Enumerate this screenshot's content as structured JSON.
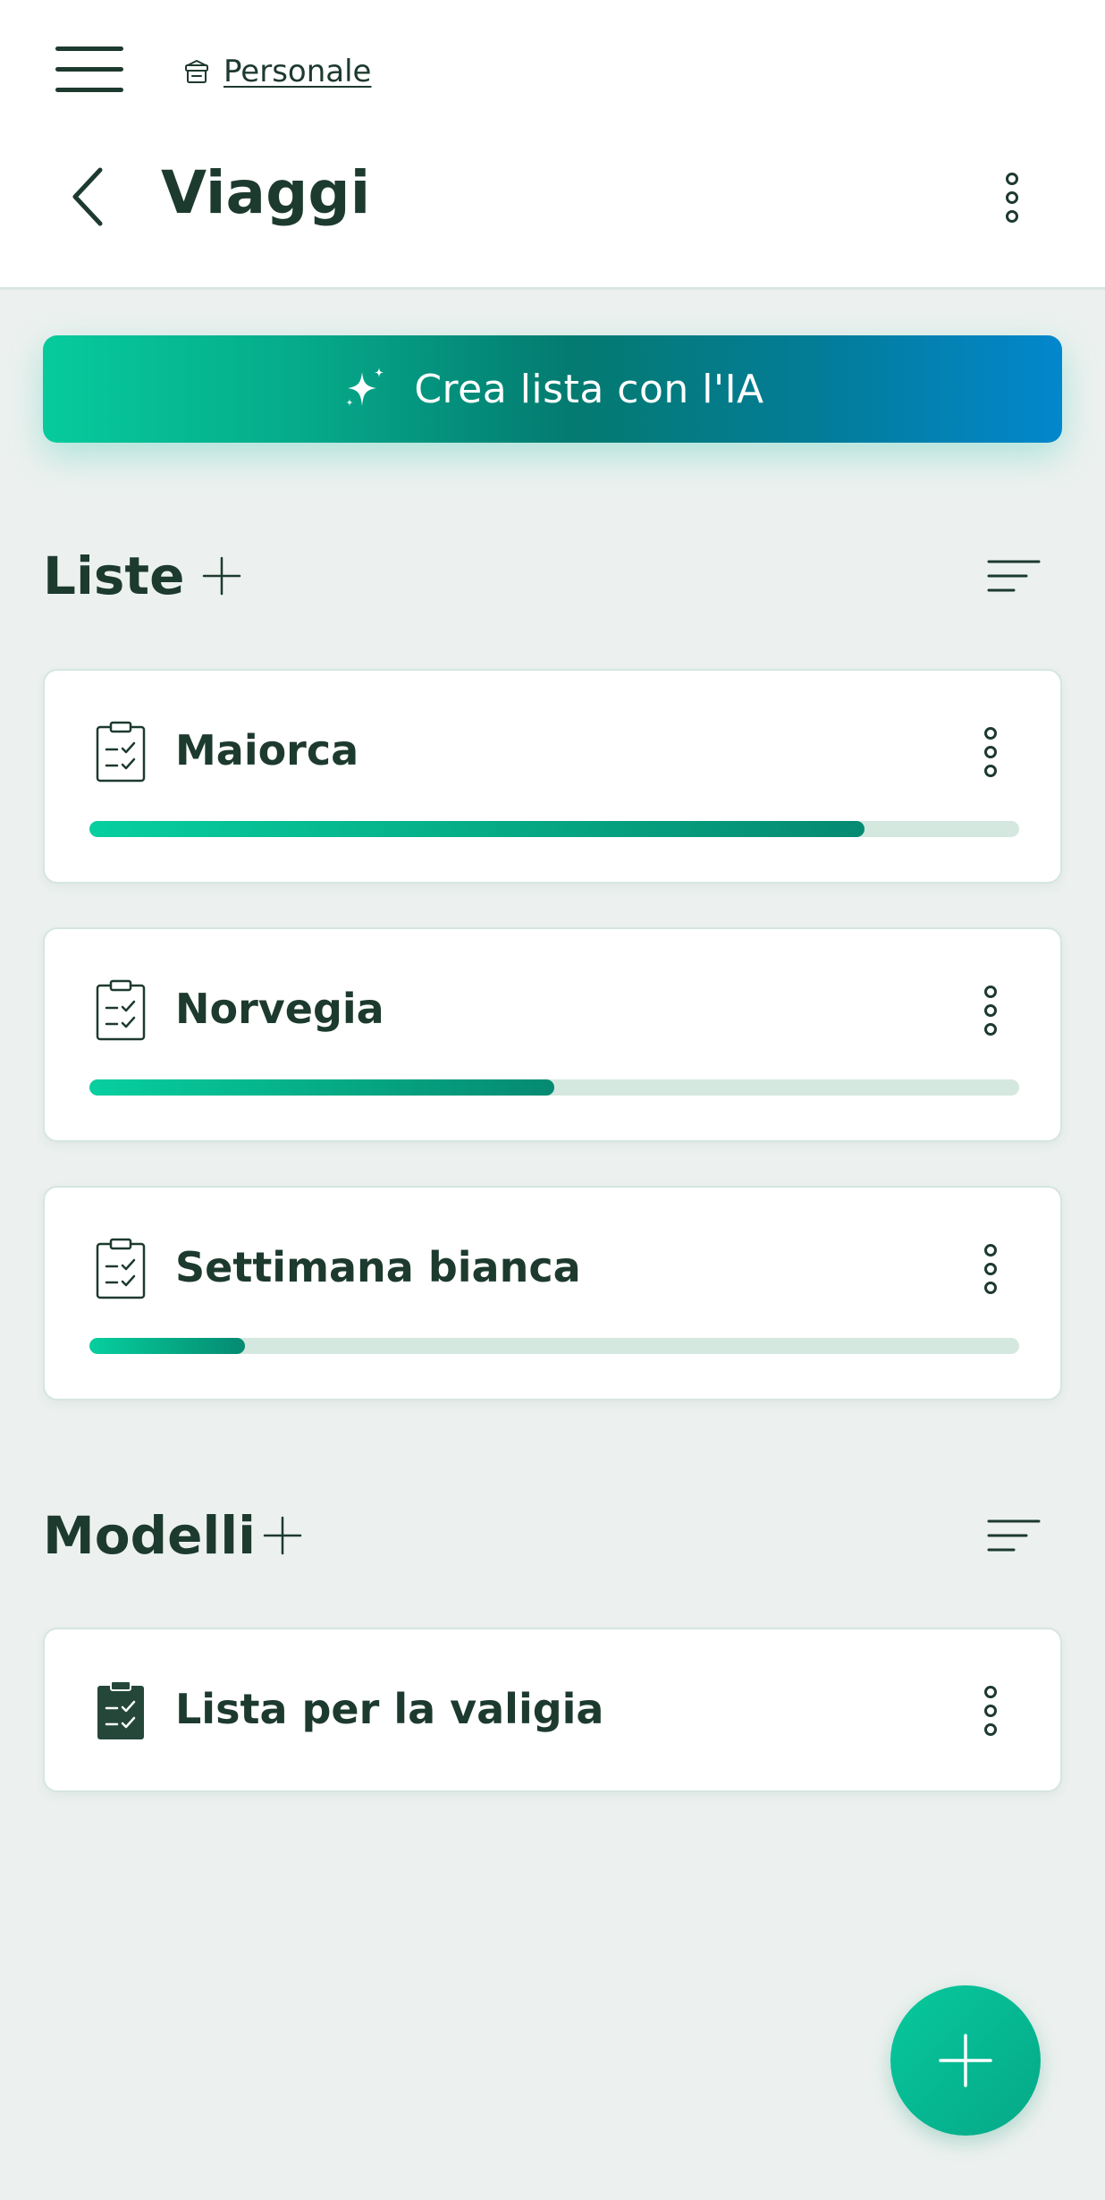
{
  "header": {
    "menu_icon": "hamburger-menu-icon",
    "breadcrumb": {
      "icon": "archive-box-icon",
      "label": "Personale"
    },
    "back_icon": "chevron-left-icon",
    "title": "Viaggi",
    "more_icon": "vertical-dots-icon"
  },
  "ai_button": {
    "icon": "sparkle-icon",
    "label": "Crea lista con l'IA",
    "gradient": [
      "#06cb9c",
      "#047a70",
      "#0387cd"
    ]
  },
  "lists_section": {
    "title": "Liste",
    "add_icon": "plus-icon",
    "sort_icon": "sort-lines-icon",
    "items": [
      {
        "title": "Maiorca",
        "icon": "clipboard-checklist-outline-icon",
        "progress": 0.834
      },
      {
        "title": "Norvegia",
        "icon": "clipboard-checklist-outline-icon",
        "progress": 0.5
      },
      {
        "title": "Settimana bianca",
        "icon": "clipboard-checklist-outline-icon",
        "progress": 0.167
      }
    ]
  },
  "templates_section": {
    "title": "Modelli",
    "add_icon": "plus-icon",
    "sort_icon": "sort-lines-icon",
    "items": [
      {
        "title": "Lista per la valigia",
        "icon": "clipboard-checklist-filled-icon"
      }
    ]
  },
  "fab": {
    "icon": "plus-icon"
  },
  "colors": {
    "text_primary": "#1d3a2e",
    "background": "#ecf1ef",
    "accent": "#06c89b",
    "progress_track": "#d4e8df"
  }
}
